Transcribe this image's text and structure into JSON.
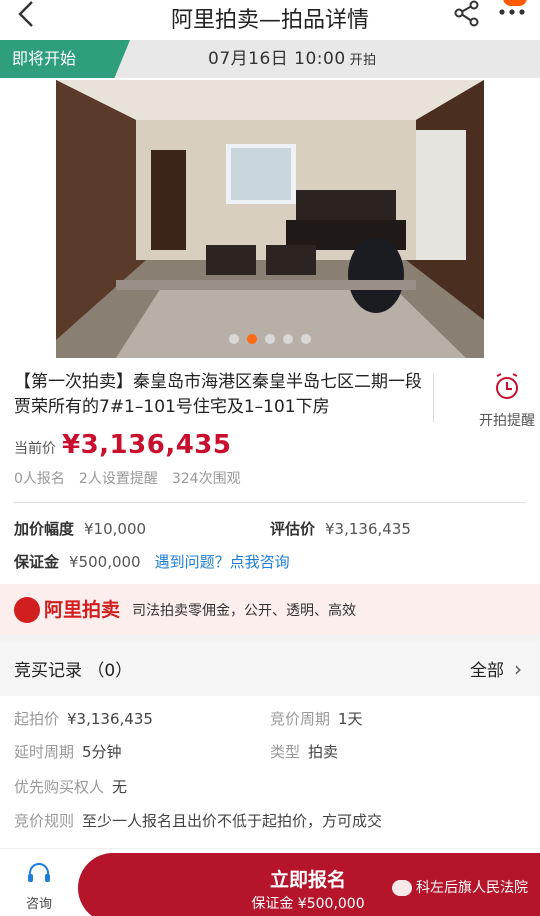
{
  "nav": {
    "title": "阿里拍卖—拍品详情"
  },
  "status": {
    "tag": "即将开始",
    "time": "07月16日 10:00",
    "time_suffix": "开拍"
  },
  "gallery": {
    "total_images": 5,
    "active_index": 1
  },
  "item": {
    "title": "【第一次拍卖】秦皇岛市海港区秦皇半岛七区二期一段贾荣所有的7#1–101号住宅及1–101下房",
    "reminder_label": "开拍提醒",
    "price_label": "当前价",
    "price": "¥3,136,435",
    "signups": "0人报名",
    "reminders_set": "2人设置提醒",
    "views": "324次围观",
    "increment_label": "加价幅度",
    "increment": "¥10,000",
    "appraisal_label": "评估价",
    "appraisal": "¥3,136,435",
    "deposit_label": "保证金",
    "deposit": "¥500,000",
    "help_link": "遇到问题？点我咨询"
  },
  "brand": {
    "name": "阿里拍卖",
    "slogan": "司法拍卖零佣金，公开、透明、高效"
  },
  "records": {
    "title": "竞买记录 （0）",
    "all_label": "全部"
  },
  "details": {
    "start_price_label": "起拍价",
    "start_price": "¥3,136,435",
    "cycle_label": "竞价周期",
    "cycle": "1天",
    "delay_label": "延时周期",
    "delay": "5分钟",
    "type_label": "类型",
    "type": "拍卖",
    "priority_label": "优先购买权人",
    "priority": "无",
    "rule_label": "竞价规则",
    "rule": "至少一人报名且出价不低于起拍价，方可成交"
  },
  "bottom": {
    "consult_label": "咨询",
    "signup_label": "立即报名",
    "signup_sub": "保证金 ¥500,000",
    "watermark": "科左后旗人民法院"
  },
  "colors": {
    "accent_red": "#c8102e",
    "tag_green": "#2e9e7d",
    "link_blue": "#1e7fd8",
    "dot_active": "#ff6a13"
  }
}
